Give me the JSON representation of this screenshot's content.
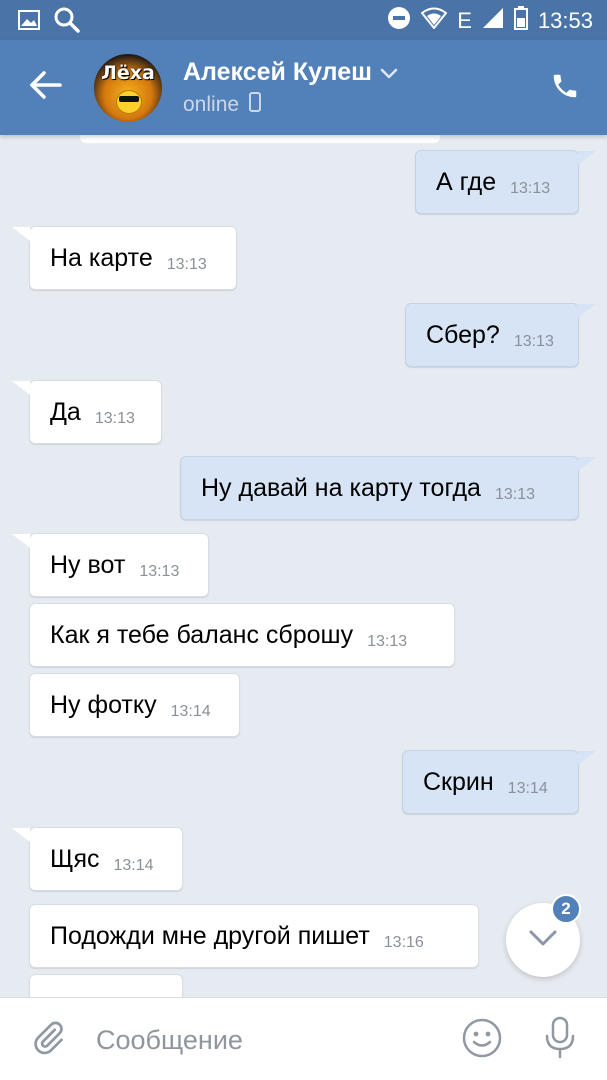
{
  "status_bar": {
    "time": "13:53",
    "network_letter": "E"
  },
  "header": {
    "avatar_text": "Лёха",
    "contact_name": "Алексей Кулеш",
    "status": "online",
    "colors": {
      "bar": "#5281b9",
      "status_bar": "#4a74a8"
    }
  },
  "messages": [
    {
      "dir": "out",
      "text": "А где",
      "time": "13:13"
    },
    {
      "dir": "in",
      "text": "На карте",
      "time": "13:13"
    },
    {
      "dir": "out",
      "text": "Сбер?",
      "time": "13:13"
    },
    {
      "dir": "in",
      "text": "Да",
      "time": "13:13"
    },
    {
      "dir": "out",
      "text": "Ну давай на карту тогда",
      "time": "13:13"
    },
    {
      "dir": "in",
      "text": "Ну вот",
      "time": "13:13"
    },
    {
      "dir": "in",
      "text": "Как я тебе баланс сброшу",
      "time": "13:13"
    },
    {
      "dir": "in",
      "text": "Ну фотку",
      "time": "13:14"
    },
    {
      "dir": "out",
      "text": "Скрин",
      "time": "13:14"
    },
    {
      "dir": "in",
      "text": "Щяс",
      "time": "13:14"
    },
    {
      "dir": "in",
      "text": "Подожди мне другой пишет",
      "time": "13:16"
    }
  ],
  "scroll_down": {
    "unread_count": "2"
  },
  "composer": {
    "placeholder": "Сообщение"
  },
  "icons": {
    "back": "arrow-left-icon",
    "phone": "phone-icon",
    "attach": "paperclip-icon",
    "emoji": "smiley-icon",
    "mic": "microphone-icon",
    "chevron": "chevron-down-icon"
  }
}
